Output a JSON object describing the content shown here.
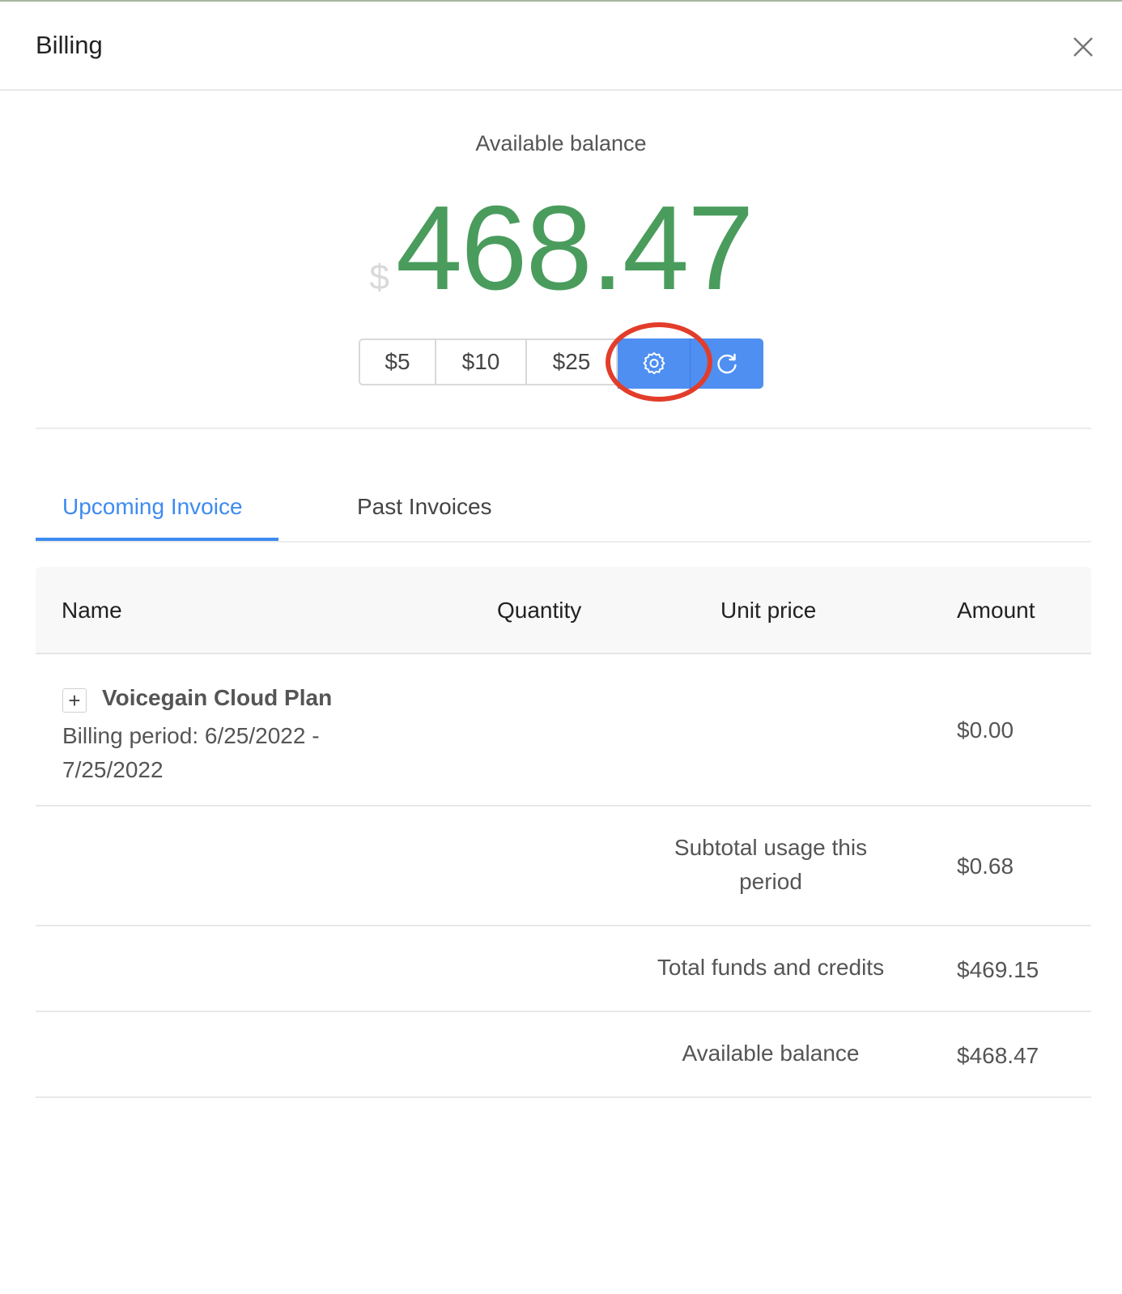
{
  "header": {
    "title": "Billing"
  },
  "balance": {
    "label": "Available balance",
    "currency": "$",
    "amount": "468.47"
  },
  "topup_buttons": [
    "$5",
    "$10",
    "$25"
  ],
  "icons": {
    "settings": "gear-icon",
    "refresh": "refresh-icon",
    "close": "close-icon",
    "expand": "plus-icon"
  },
  "colors": {
    "accent": "#4e8ff1",
    "balance": "#4a9c5d",
    "highlight": "#e23d2b"
  },
  "tabs": [
    {
      "label": "Upcoming Invoice",
      "active": true
    },
    {
      "label": "Past Invoices",
      "active": false
    }
  ],
  "table": {
    "columns": [
      "Name",
      "Quantity",
      "Unit price",
      "Amount"
    ],
    "plan_row": {
      "expand": "+",
      "name": "Voicegain Cloud Plan",
      "period": "Billing period: 6/25/2022 - 7/25/2022",
      "amount": "$0.00"
    },
    "summary": [
      {
        "label": "Subtotal usage this period",
        "amount": "$0.68"
      },
      {
        "label": "Total funds and credits",
        "amount": "$469.15"
      },
      {
        "label": "Available balance",
        "amount": "$468.47"
      }
    ]
  }
}
